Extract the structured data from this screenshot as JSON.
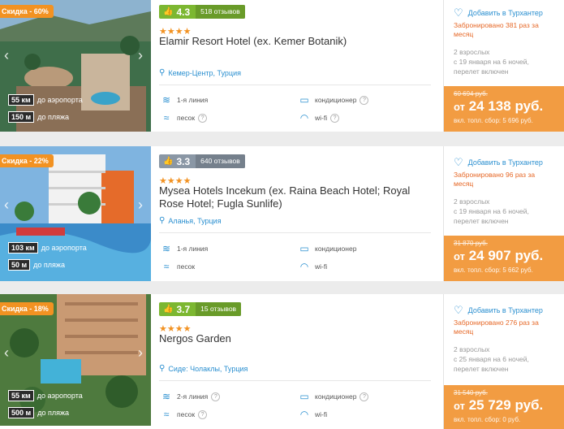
{
  "hotels": [
    {
      "discount": "Скидка - 60%",
      "rating": "4.3",
      "reviews": "518 отзывов",
      "rating_color": "#7cb731",
      "stars": "★★★★",
      "name": "Elamir Resort Hotel (ex. Kemer Botanik)",
      "location": "Кемер-Центр, Турция",
      "airport_km": "55 км",
      "airport_label": "до аэропорта",
      "beach_m": "150 м",
      "beach_label": "до пляжа",
      "line": "1-я линия",
      "beach_type": "песок",
      "ac": "кондиционер",
      "wifi": "wi-fi",
      "fav": "Добавить в Турхантер",
      "booked": "Забронировано 381 раз за месяц",
      "pax_1": "2 взрослых",
      "pax_2": "с 19 января на 6 ночей,",
      "pax_3": "перелет включен",
      "old_price": "60 694 руб.",
      "price_prefix": "от",
      "price": "24 138 руб.",
      "fee": "вкл. топл. сбор: 5 696 руб."
    },
    {
      "discount": "Скидка - 22%",
      "rating": "3.3",
      "reviews": "640 отзывов",
      "rating_color": "#8a97a5",
      "stars": "★★★★",
      "name": "Mysea Hotels Incekum (ex. Raina Beach Hotel; Royal Rose Hotel; Fugla Sunlife)",
      "location": "Аланья, Турция",
      "airport_km": "103 км",
      "airport_label": "до аэропорта",
      "beach_m": "50 м",
      "beach_label": "до пляжа",
      "line": "1-я линия",
      "beach_type": "песок",
      "ac": "кондиционер",
      "wifi": "wi-fi",
      "fav": "Добавить в Турхантер",
      "booked": "Забронировано 96 раз за месяц",
      "pax_1": "2 взрослых",
      "pax_2": "с 19 января на 6 ночей,",
      "pax_3": "перелет включен",
      "old_price": "31 870 руб.",
      "price_prefix": "от",
      "price": "24 907 руб.",
      "fee": "вкл. топл. сбор: 5 662 руб."
    },
    {
      "discount": "Скидка - 18%",
      "rating": "3.7",
      "reviews": "15 отзывов",
      "rating_color": "#7cb731",
      "stars": "★★★★",
      "name": "Nergos Garden",
      "location": "Сиде: Чолаклы, Турция",
      "airport_km": "55 км",
      "airport_label": "до аэропорта",
      "beach_m": "500 м",
      "beach_label": "до пляжа",
      "line": "2-я линия",
      "beach_type": "песок",
      "ac": "кондиционер",
      "wifi": "wi-fi",
      "fav": "Добавить в Турхантер",
      "booked": "Забронировано 276 раз за месяц",
      "pax_1": "2 взрослых",
      "pax_2": "с 25 января на 6 ночей,",
      "pax_3": "перелет включен",
      "old_price": "31 540 руб.",
      "price_prefix": "от",
      "price": "25 729 руб.",
      "fee": "вкл. топл. сбор: 0 руб."
    }
  ],
  "colors": {
    "accent_orange": "#f29c42",
    "link_blue": "#2a8fd0",
    "booked_red": "#e66827"
  },
  "icons": {
    "thumb": "thumbs-up-icon",
    "pin": "location-pin-icon",
    "heart": "heart-icon"
  }
}
